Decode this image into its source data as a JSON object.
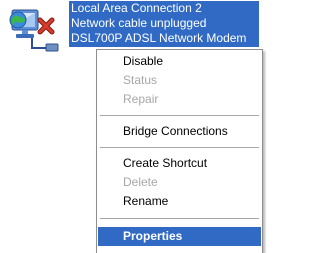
{
  "connection": {
    "icon": "network-connection-icon",
    "status_overlay_icon": "red-x-icon",
    "name": "Local Area Connection 2",
    "status": "Network cable unplugged",
    "device": "DSL700P ADSL Network Modem"
  },
  "context_menu": {
    "items": [
      {
        "label": "Disable",
        "enabled": true
      },
      {
        "label": "Status",
        "enabled": false
      },
      {
        "label": "Repair",
        "enabled": false
      },
      {
        "label": "Bridge Connections",
        "enabled": true
      },
      {
        "label": "Create Shortcut",
        "enabled": true
      },
      {
        "label": "Delete",
        "enabled": false
      },
      {
        "label": "Rename",
        "enabled": true
      },
      {
        "label": "Properties",
        "enabled": true,
        "selected": true,
        "default": true
      }
    ]
  },
  "colors": {
    "selection": "#316ac5",
    "disabled_text": "#a7a6aa",
    "status_x": "#cc2a1c"
  }
}
